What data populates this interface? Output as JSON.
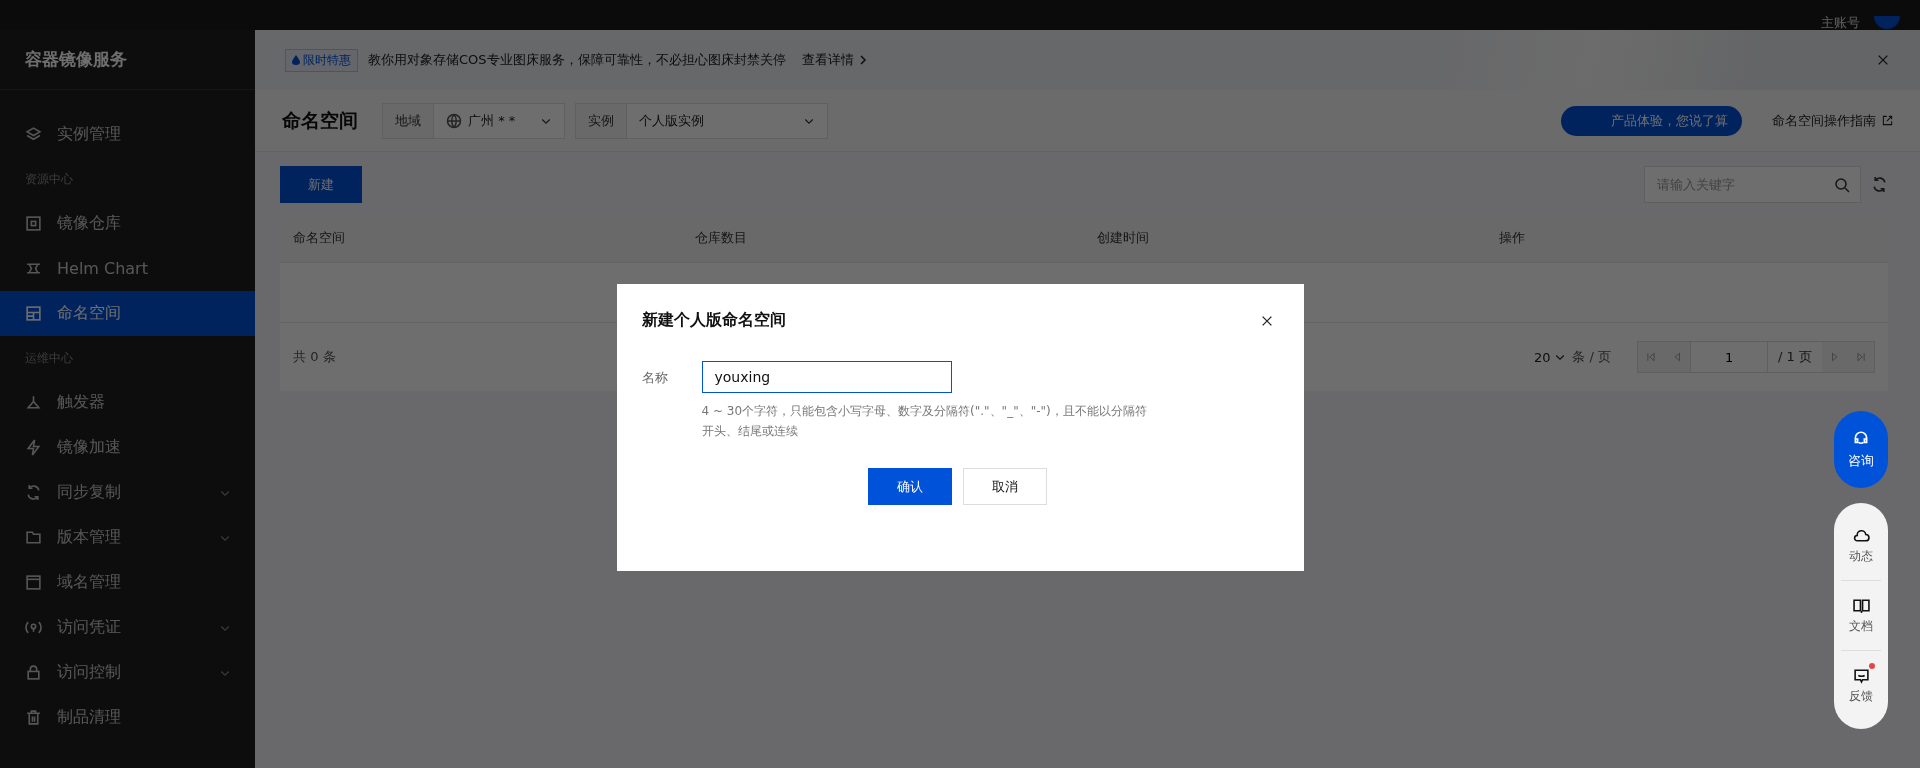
{
  "top_bar": {
    "account_label": "主账号"
  },
  "sidebar": {
    "title": "容器镜像服务",
    "items": [
      {
        "kind": "item",
        "label": "实例管理",
        "selected": false,
        "has_submenu": false
      },
      {
        "kind": "section",
        "label": "资源中心"
      },
      {
        "kind": "item",
        "label": "镜像仓库",
        "selected": false,
        "has_submenu": false
      },
      {
        "kind": "item",
        "label": "Helm Chart",
        "selected": false,
        "has_submenu": false
      },
      {
        "kind": "item",
        "label": "命名空间",
        "selected": true,
        "has_submenu": false
      },
      {
        "kind": "section",
        "label": "运维中心"
      },
      {
        "kind": "item",
        "label": "触发器",
        "selected": false,
        "has_submenu": false
      },
      {
        "kind": "item",
        "label": "镜像加速",
        "selected": false,
        "has_submenu": false
      },
      {
        "kind": "item",
        "label": "同步复制",
        "selected": false,
        "has_submenu": true
      },
      {
        "kind": "item",
        "label": "版本管理",
        "selected": false,
        "has_submenu": true
      },
      {
        "kind": "item",
        "label": "域名管理",
        "selected": false,
        "has_submenu": false
      },
      {
        "kind": "item",
        "label": "访问凭证",
        "selected": false,
        "has_submenu": true
      },
      {
        "kind": "item",
        "label": "访问控制",
        "selected": false,
        "has_submenu": true
      },
      {
        "kind": "item",
        "label": "制品清理",
        "selected": false,
        "has_submenu": false
      }
    ]
  },
  "banner": {
    "tag": "限时特惠",
    "text": "教你用对象存储COS专业图床服务，保障可靠性，不必担心图床封禁关停",
    "link": "查看详情"
  },
  "header": {
    "title": "命名空间",
    "region_label": "地域",
    "region_value": "广州 * *",
    "instance_label": "实例",
    "instance_value": "个人版实例",
    "promo": "产品体验，您说了算",
    "guide_link": "命名空间操作指南"
  },
  "toolbar": {
    "new_button": "新建",
    "search": {
      "placeholder": "请输入关键字"
    }
  },
  "table": {
    "columns": [
      "命名空间",
      "仓库数目",
      "创建时间",
      "操作"
    ]
  },
  "pagination": {
    "total": "共 0 条",
    "page_size": "20",
    "per_page": "条 / 页",
    "page": "1",
    "page_total": "/ 1 页"
  },
  "dialog": {
    "title": "新建个人版命名空间",
    "field_label": "名称",
    "field_value": "youxing",
    "hint": "4 ~ 30个字符，只能包含小写字母、数字及分隔符(\".\"、\"_\"、\"-\")，且不能以分隔符开头、结尾或连续",
    "confirm": "确认",
    "cancel": "取消"
  },
  "float_tools": {
    "consult": "咨询",
    "tools": [
      {
        "label": "动态",
        "has_notice": false
      },
      {
        "label": "文档",
        "has_notice": false
      },
      {
        "label": "反馈",
        "has_notice": true
      }
    ]
  }
}
